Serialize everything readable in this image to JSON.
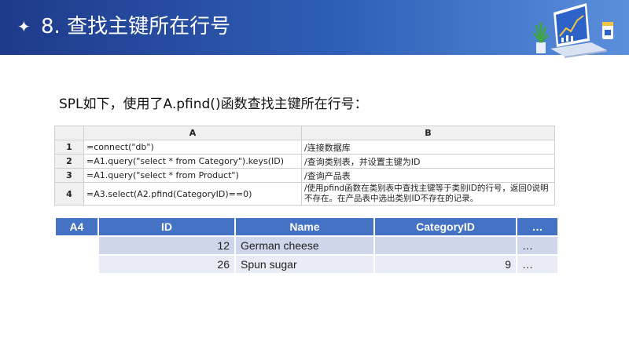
{
  "header": {
    "bullet_icon": "sparkle-icon",
    "title": "8. 查找主键所在行号",
    "illustration_icon": "laptop-chart-icon"
  },
  "intro": "SPL如下，使用了A.pfind()函数查找主键所在行号：",
  "code_grid": {
    "columns": [
      "A",
      "B"
    ],
    "rows": [
      {
        "num": "1",
        "a": "=connect(\"db\")",
        "b": "/连接数据库"
      },
      {
        "num": "2",
        "a": "=A1.query(\"select * from Category\").keys(ID)",
        "b": "/查询类别表，并设置主键为ID"
      },
      {
        "num": "3",
        "a": "=A1.query(\"select * from Product\")",
        "b": "/查询产品表"
      },
      {
        "num": "4",
        "a": "=A3.select(A2.pfind(CategoryID)==0)",
        "b": "/使用pfind函数在类别表中查找主键等于类别ID的行号，返回0说明不存在。在产品表中选出类别ID不存在的记录。"
      }
    ]
  },
  "result": {
    "cell": "A4",
    "columns": [
      "ID",
      "Name",
      "CategoryID",
      "…"
    ],
    "rows": [
      {
        "id": "12",
        "name": "German cheese",
        "category_id": "",
        "more": "…"
      },
      {
        "id": "26",
        "name": "Spun sugar",
        "category_id": "9",
        "more": "…"
      }
    ]
  },
  "colors": {
    "header_dark": "#1e3a8a",
    "header_light": "#5b8fdb",
    "result_header": "#4472c4",
    "result_row_odd": "#cfd5ea",
    "result_row_even": "#e9ebf5"
  }
}
